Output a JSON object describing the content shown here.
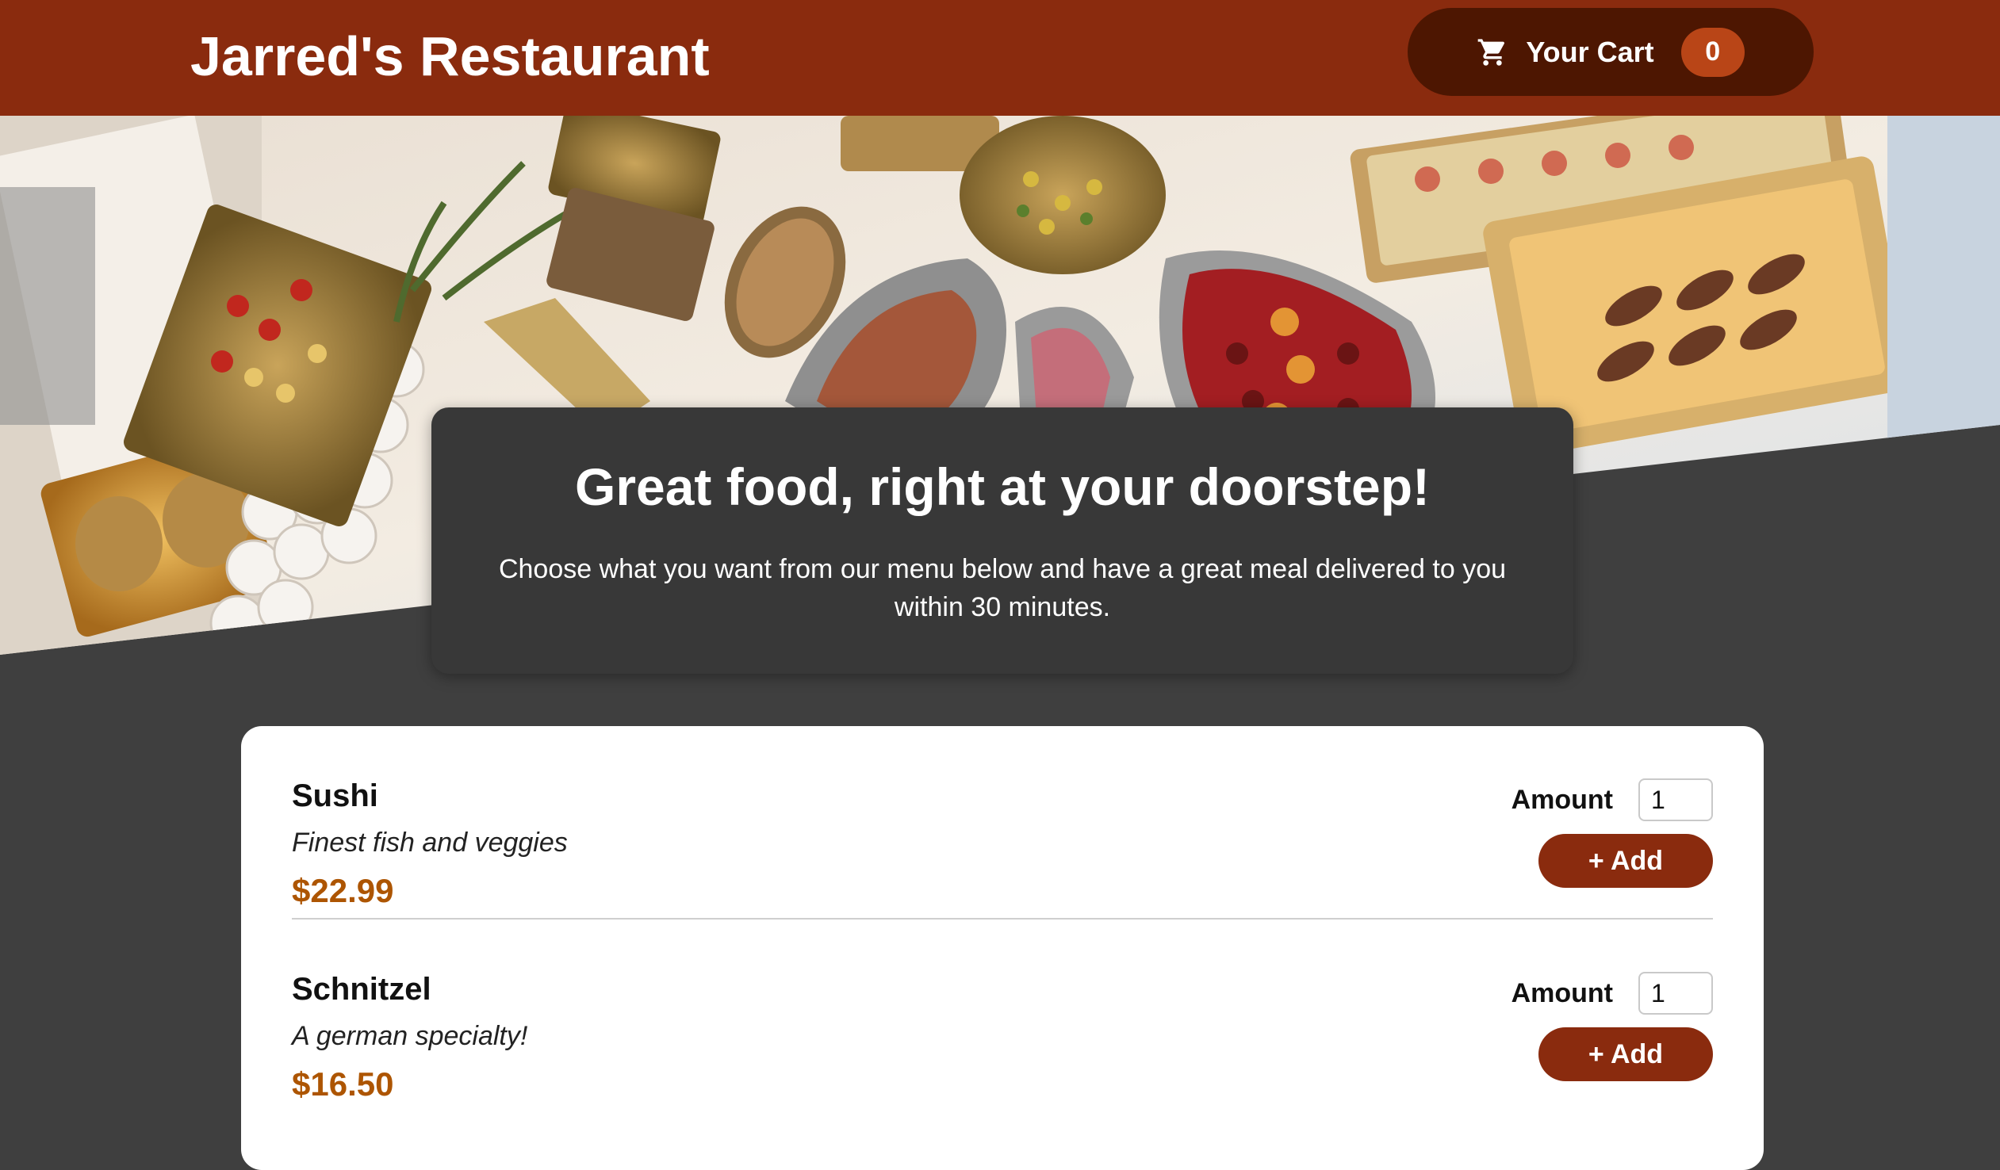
{
  "header": {
    "brand": "Jarred's Restaurant",
    "cart": {
      "label": "Your Cart",
      "count": "0",
      "icon": "cart-icon"
    }
  },
  "summary": {
    "title": "Great food, right at your doorstep!",
    "text": "Choose what you want from our menu below and have a great meal delivered to you within 30 minutes."
  },
  "meals": [
    {
      "name": "Sushi",
      "description": "Finest fish and veggies",
      "price": "$22.99",
      "amount_label": "Amount",
      "amount_value": "1",
      "add_label": "+ Add"
    },
    {
      "name": "Schnitzel",
      "description": "A german specialty!",
      "price": "$16.50",
      "amount_label": "Amount",
      "amount_value": "1",
      "add_label": "+ Add"
    }
  ],
  "colors": {
    "header": "#8a2b0e",
    "cart_button": "#4d1601",
    "badge": "#b94517",
    "price": "#ad5502",
    "background": "#3f3f3f"
  }
}
